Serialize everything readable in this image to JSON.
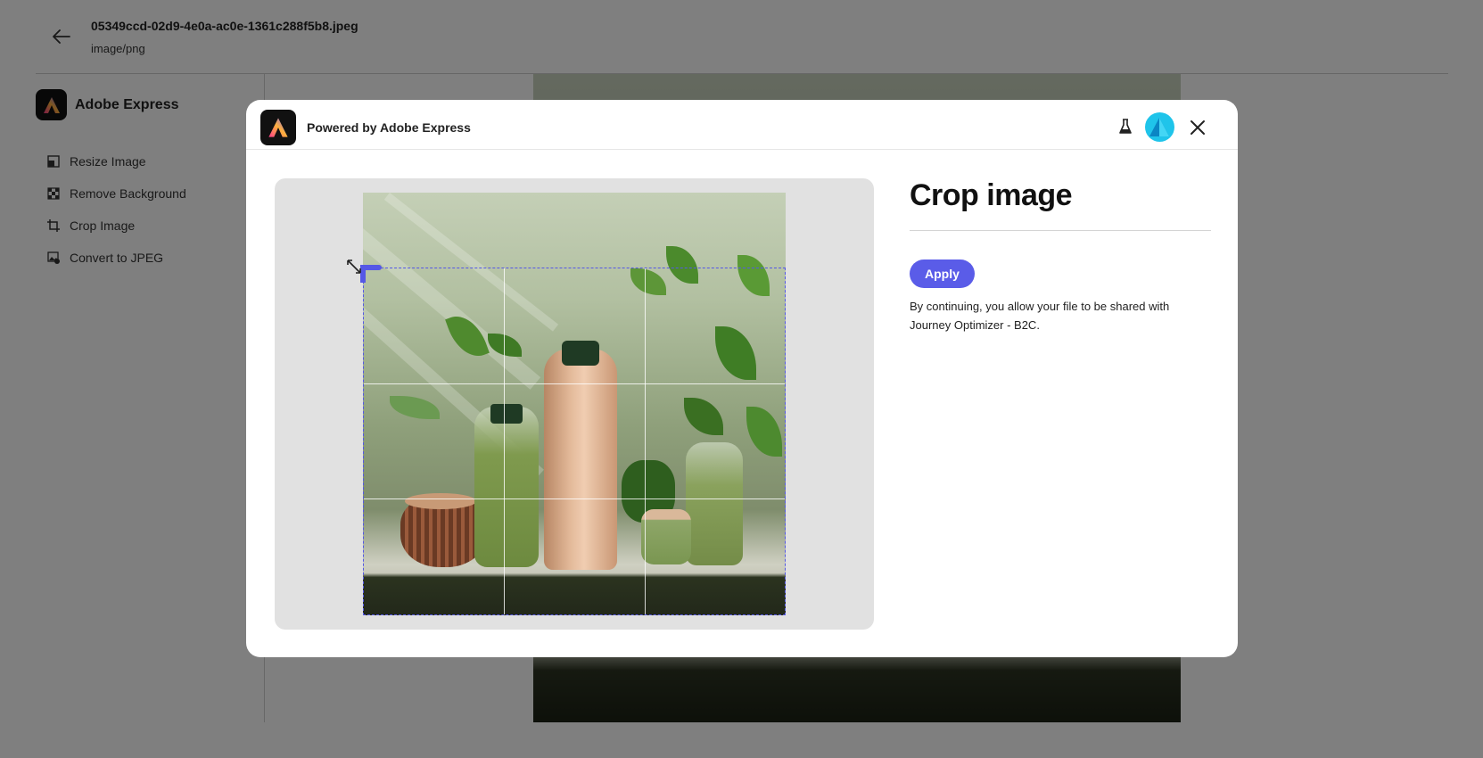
{
  "header": {
    "file_name": "05349ccd-02d9-4e0a-ac0e-1361c288f5b8.jpeg",
    "file_type": "image/png"
  },
  "sidebar": {
    "brand": "Adobe Express",
    "items": [
      {
        "label": "Resize Image",
        "icon": "resize-icon"
      },
      {
        "label": "Remove Background",
        "icon": "checkerboard-icon"
      },
      {
        "label": "Crop Image",
        "icon": "crop-icon"
      },
      {
        "label": "Convert to JPEG",
        "icon": "convert-image-icon"
      }
    ]
  },
  "modal": {
    "title": "Powered by Adobe Express",
    "panel_title": "Crop image",
    "apply_label": "Apply",
    "consent_text": "By continuing, you allow your file to be shared with Journey Optimizer - B2C.",
    "icons": [
      "adobe-express-logo-icon",
      "flask-icon",
      "avatar",
      "close-icon"
    ]
  },
  "colors": {
    "accent": "#5a5ce8",
    "overlay": "rgba(0,0,0,0.5)",
    "avatar": "#1fc4ea"
  }
}
